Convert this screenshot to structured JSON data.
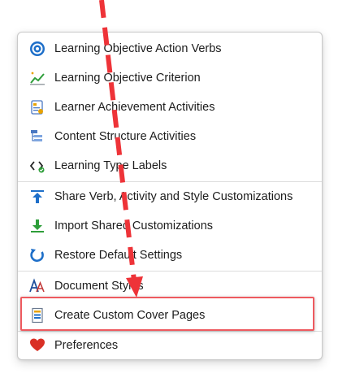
{
  "menu": {
    "items": [
      {
        "label": "Learning Objective Action Verbs",
        "icon": "target-icon"
      },
      {
        "label": "Learning Objective Criterion",
        "icon": "trend-chart-icon"
      },
      {
        "label": "Learner Achievement Activities",
        "icon": "achievement-icon"
      },
      {
        "label": "Content Structure Activities",
        "icon": "structure-icon"
      },
      {
        "label": "Learning Type Labels",
        "icon": "label-tag-icon"
      },
      {
        "label": "Share Verb, Activity and Style Customizations",
        "icon": "arrow-up-icon"
      },
      {
        "label": "Import Shared Customizations",
        "icon": "arrow-down-icon"
      },
      {
        "label": "Restore Default Settings",
        "icon": "restore-icon"
      },
      {
        "label": "Document Styles",
        "icon": "document-styles-icon"
      },
      {
        "label": "Create Custom Cover Pages",
        "icon": "cover-page-icon"
      },
      {
        "label": "Preferences",
        "icon": "heart-icon"
      }
    ]
  },
  "colors": {
    "annotation_red": "#ee3338",
    "highlight_border": "#ee5a5f",
    "blue_accent": "#1e6fc9",
    "green_accent": "#2e9e3a",
    "heart_red": "#d93025"
  }
}
